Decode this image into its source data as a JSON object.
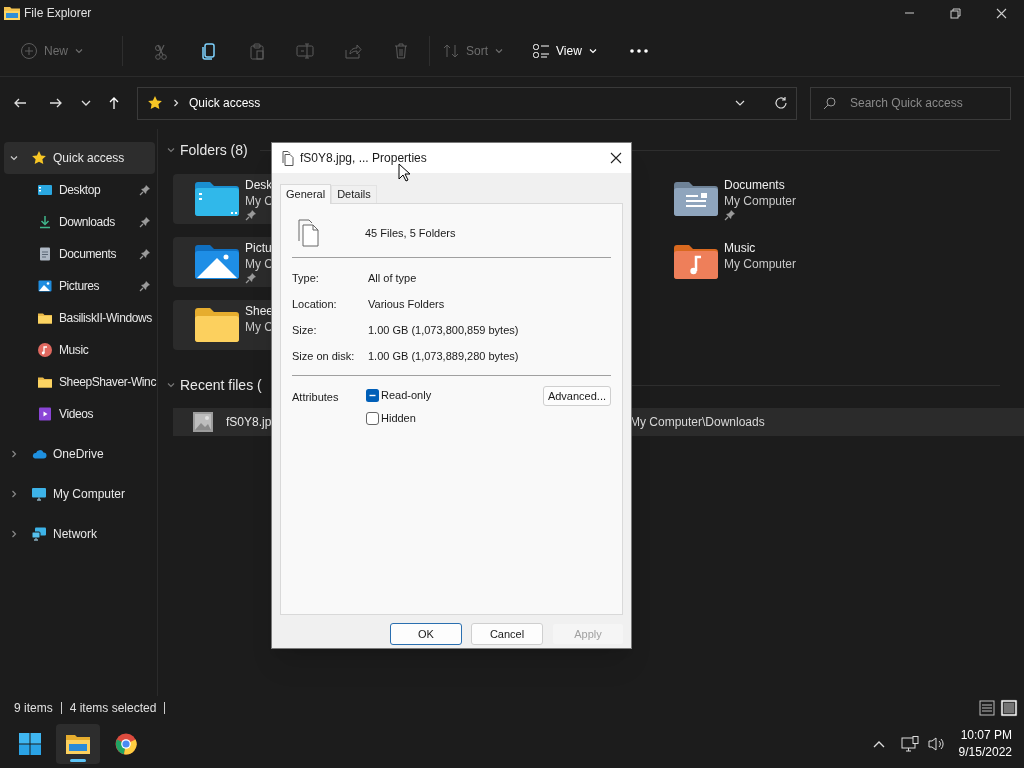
{
  "window": {
    "title": "File Explorer"
  },
  "toolbar": [
    [
      {
        "kind": "menu",
        "label": "New",
        "disabled": true
      }
    ],
    [
      {
        "kind": "icon",
        "disabled": true
      },
      {
        "kind": "icon",
        "disabled": false
      },
      {
        "kind": "icon",
        "disabled": true
      },
      {
        "kind": "icon",
        "disabled": true
      },
      {
        "kind": "icon",
        "disabled": true
      },
      {
        "kind": "icon",
        "disabled": true
      }
    ],
    [
      {
        "kind": "menu",
        "label": "Sort",
        "disabled": true
      },
      {
        "kind": "menu",
        "label": "View",
        "disabled": false
      },
      {
        "kind": "more",
        "disabled": false
      }
    ]
  ],
  "address": {
    "path": "Quick access"
  },
  "search": {
    "placeholder": "Search Quick access"
  },
  "sidebar": {
    "items": [
      {
        "label": "Quick access",
        "kind": "star",
        "selected": true,
        "expanded": true,
        "children": [
          {
            "label": "Desktop",
            "kind": "desktop",
            "pinned": true
          },
          {
            "label": "Downloads",
            "kind": "downloads",
            "pinned": true
          },
          {
            "label": "Documents",
            "kind": "documents",
            "pinned": true
          },
          {
            "label": "Pictures",
            "kind": "pictures",
            "pinned": true
          },
          {
            "label": "BasiliskII-Windows",
            "kind": "folder",
            "pinned": false
          },
          {
            "label": "Music",
            "kind": "music",
            "pinned": false
          },
          {
            "label": "SheepShaver-Winc",
            "kind": "folder",
            "pinned": false
          },
          {
            "label": "Videos",
            "kind": "videos",
            "pinned": false
          }
        ]
      },
      {
        "label": "OneDrive",
        "kind": "cloud",
        "selected": false,
        "expanded": false
      },
      {
        "label": "My Computer",
        "kind": "computer",
        "selected": false,
        "expanded": false
      },
      {
        "label": "Network",
        "kind": "network",
        "selected": false,
        "expanded": false
      }
    ]
  },
  "folders": {
    "title": "Folders (8)",
    "expanded": true,
    "left_column": [
      {
        "name": "Desk",
        "location": "My C",
        "kind": "desktop",
        "pinned": true,
        "selected": true
      },
      {
        "name": "Pictu",
        "location": "My C",
        "kind": "pictures",
        "pinned": true,
        "selected": true
      },
      {
        "name": "Shee",
        "location": "My C",
        "kind": "folder",
        "pinned": false,
        "selected": true
      }
    ],
    "right_column": [
      {
        "name": "Documents",
        "location": "My Computer",
        "kind": "documents",
        "pinned": true,
        "selected": false
      },
      {
        "name": "Music",
        "location": "My Computer",
        "kind": "music",
        "pinned": false,
        "selected": false
      }
    ]
  },
  "recent_files": {
    "title": "Recent files (",
    "expanded": true,
    "rows": [
      {
        "name": "fS0Y8.jp",
        "location": "My Computer\\Downloads",
        "selected": true
      }
    ]
  },
  "status_bar": {
    "count": "9 items",
    "selection": "4 items selected",
    "view_modes": [
      {
        "selected": false
      },
      {
        "selected": true
      }
    ]
  },
  "taskbar": {
    "apps": [
      {
        "kind": "start",
        "active": false
      },
      {
        "kind": "explorer",
        "active": true
      },
      {
        "kind": "browser",
        "active": false
      }
    ],
    "time": "10:07 PM",
    "date": "9/15/2022"
  },
  "dialog": {
    "title": "fS0Y8.jpg, ... Properties",
    "tabs": [
      {
        "label": "General",
        "selected": true
      },
      {
        "label": "Details",
        "selected": false
      }
    ],
    "summary": "45 Files, 5 Folders",
    "fields": [
      {
        "label": "Type:",
        "value": "All of type"
      },
      {
        "label": "Location:",
        "value": "Various Folders"
      },
      {
        "label": "Size:",
        "value": "1.00 GB (1,073,800,859 bytes)"
      },
      {
        "label": "Size on disk:",
        "value": "1.00 GB (1,073,889,280 bytes)"
      }
    ],
    "attributes": {
      "label": "Attributes",
      "options": [
        {
          "label": "Read-only",
          "checked": false,
          "indeterminate": true
        },
        {
          "label": "Hidden",
          "checked": false,
          "indeterminate": false
        }
      ],
      "advanced": "Advanced..."
    },
    "buttons": [
      {
        "label": "OK",
        "default": true,
        "disabled": false
      },
      {
        "label": "Cancel",
        "default": false,
        "disabled": false
      },
      {
        "label": "Apply",
        "default": false,
        "disabled": true
      }
    ]
  }
}
